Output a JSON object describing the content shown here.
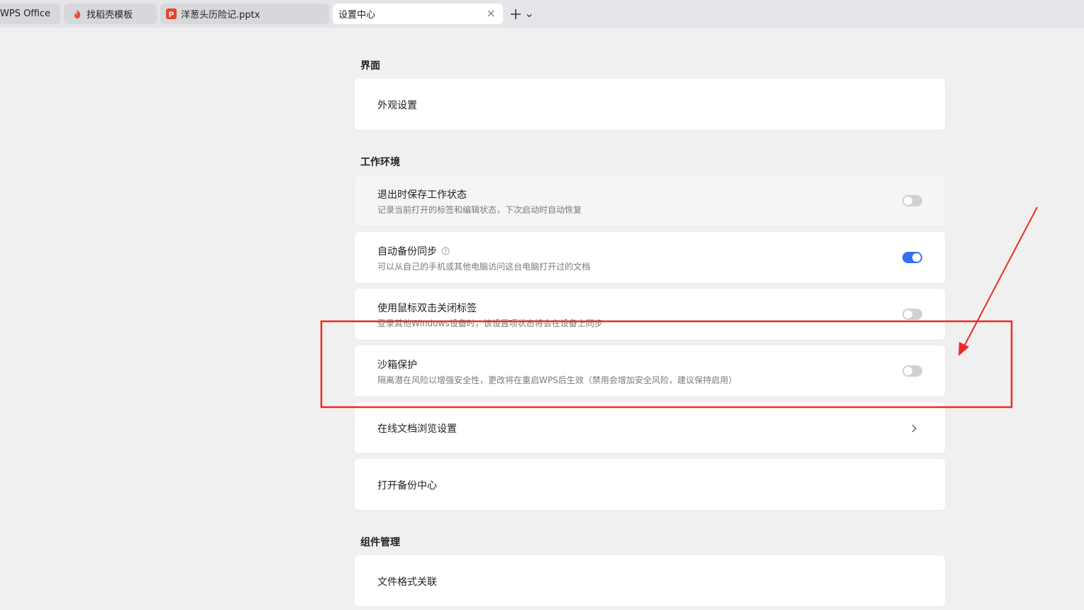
{
  "tabs": [
    {
      "label": "WPS Office",
      "icon": "wps-logo-icon"
    },
    {
      "label": "找稻壳模板",
      "icon": "docer-flame-icon"
    },
    {
      "label": "洋葱头历险记.pptx",
      "icon": "pptx-icon"
    },
    {
      "label": "设置中心",
      "icon": "settings-icon",
      "active": true
    }
  ],
  "sections": {
    "interface": {
      "title": "界面",
      "items": [
        {
          "title": "外观设置"
        }
      ]
    },
    "work_env": {
      "title": "工作环境",
      "items": [
        {
          "title": "退出时保存工作状态",
          "desc": "记录当前打开的标签和编辑状态，下次启动时自动恢复",
          "toggle": false
        },
        {
          "title": "自动备份同步",
          "desc": "可以从自己的手机或其他电脑访问这台电脑打开过的文档",
          "toggle": true,
          "help_icon": "question-circle-icon"
        },
        {
          "title": "使用鼠标双击关闭标签",
          "desc": "登录其他Windows设备时，该设置项状态将会在设备上同步",
          "toggle": false
        },
        {
          "title": "沙箱保护",
          "desc": "隔离潜在风险以增强安全性，更改将在重启WPS后生效（禁用会增加安全风险，建议保持启用）",
          "toggle": false
        },
        {
          "title": "在线文档浏览设置",
          "chevron": "chevron-right-icon"
        },
        {
          "title": "打开备份中心"
        }
      ]
    },
    "components": {
      "title": "组件管理",
      "items": [
        {
          "title": "文件格式关联"
        }
      ]
    }
  },
  "colors": {
    "background": "#f0f0f0",
    "tabbar": "#e3e5e9",
    "toggle_on": "#3470f2",
    "toggle_off": "#d0d0d0",
    "annotation_red": "#ee2a24"
  }
}
